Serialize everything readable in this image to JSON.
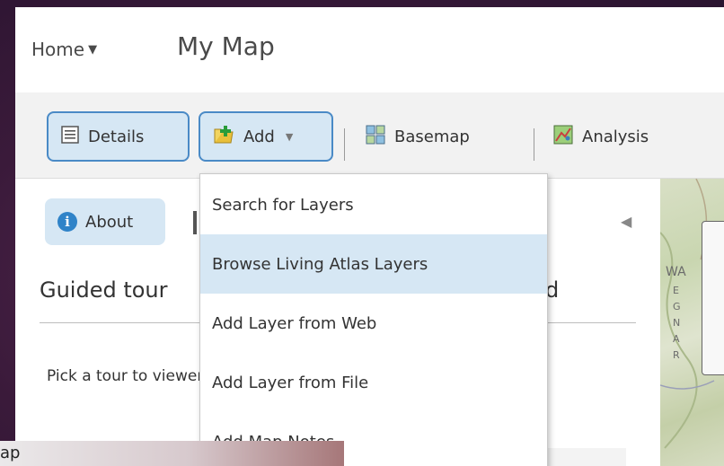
{
  "header": {
    "home_label": "Home",
    "map_title": "My Map"
  },
  "toolbar": {
    "details_label": "Details",
    "add_label": "Add",
    "basemap_label": "Basemap",
    "analysis_label": "Analysis"
  },
  "left_pane": {
    "about_tab_label": "About",
    "guided_title": "Guided tour",
    "guided_suffix": "d",
    "pick_text": "Pick a tour to viewer."
  },
  "add_menu": {
    "items": [
      {
        "label": "Search for Layers"
      },
      {
        "label": "Browse Living Atlas Layers",
        "highlighted": true
      },
      {
        "label": "Add Layer from Web"
      },
      {
        "label": "Add Layer from File"
      },
      {
        "label": "Add Map Notes"
      }
    ]
  },
  "map": {
    "labels": [
      "WA",
      "E",
      "G",
      "N",
      "A",
      "R"
    ]
  },
  "background_window": {
    "text": "ap"
  },
  "colors": {
    "accent": "#4a8ac6",
    "selected_bg": "#d6e7f4",
    "info_icon": "#2f83c8"
  }
}
